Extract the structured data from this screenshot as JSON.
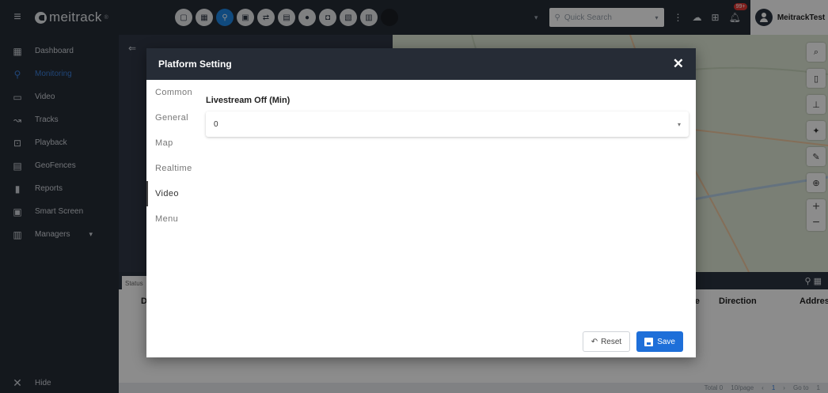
{
  "app": {
    "logo_text": "meitrack",
    "logo_mark": "®"
  },
  "topbar": {
    "quick_icons": [
      "monitor-icon",
      "grid-icon",
      "location-icon",
      "screen-icon",
      "route-icon",
      "calendar-icon",
      "user-icon",
      "car-icon",
      "id-card-icon",
      "chart-icon",
      "circle-icon"
    ],
    "search_placeholder": "Quick Search",
    "notification_count": "99+",
    "user_name": "MeitrackTest"
  },
  "sidebar": {
    "items": [
      {
        "label": "Dashboard",
        "icon": "dashboard-icon",
        "glyph": "▦"
      },
      {
        "label": "Monitoring",
        "icon": "location-pin-icon",
        "glyph": "⚲"
      },
      {
        "label": "Video",
        "icon": "video-icon",
        "glyph": "▭"
      },
      {
        "label": "Tracks",
        "icon": "tracks-icon",
        "glyph": "↝"
      },
      {
        "label": "Playback",
        "icon": "playback-icon",
        "glyph": "⊡"
      },
      {
        "label": "GeoFences",
        "icon": "geofence-icon",
        "glyph": "▤"
      },
      {
        "label": "Reports",
        "icon": "reports-icon",
        "glyph": "▮"
      },
      {
        "label": "Smart Screen",
        "icon": "smart-screen-icon",
        "glyph": "▣"
      },
      {
        "label": "Managers",
        "icon": "managers-icon",
        "glyph": "▥"
      }
    ],
    "active_index": 1,
    "hide_label": "Hide"
  },
  "table": {
    "status_tab": "Status",
    "col_de": "De",
    "col_de2": "de",
    "col_direction": "Direction",
    "col_address": "Addres"
  },
  "pagination": {
    "total": "Total 0",
    "per_page": "10/page",
    "page": "1",
    "goto_label": "Go to",
    "goto_value": "1"
  },
  "dialog": {
    "title": "Platform Setting",
    "nav": [
      "Common",
      "General",
      "Map",
      "Realtime",
      "Video",
      "Menu"
    ],
    "active_nav": 4,
    "field_label": "Livestream Off (Min)",
    "field_value": "0",
    "reset_label": "Reset",
    "save_label": "Save"
  },
  "colors": {
    "accent": "#1e6fd9",
    "sidebar_bg": "#262c36",
    "active_nav_text": "#3b7fd9"
  }
}
